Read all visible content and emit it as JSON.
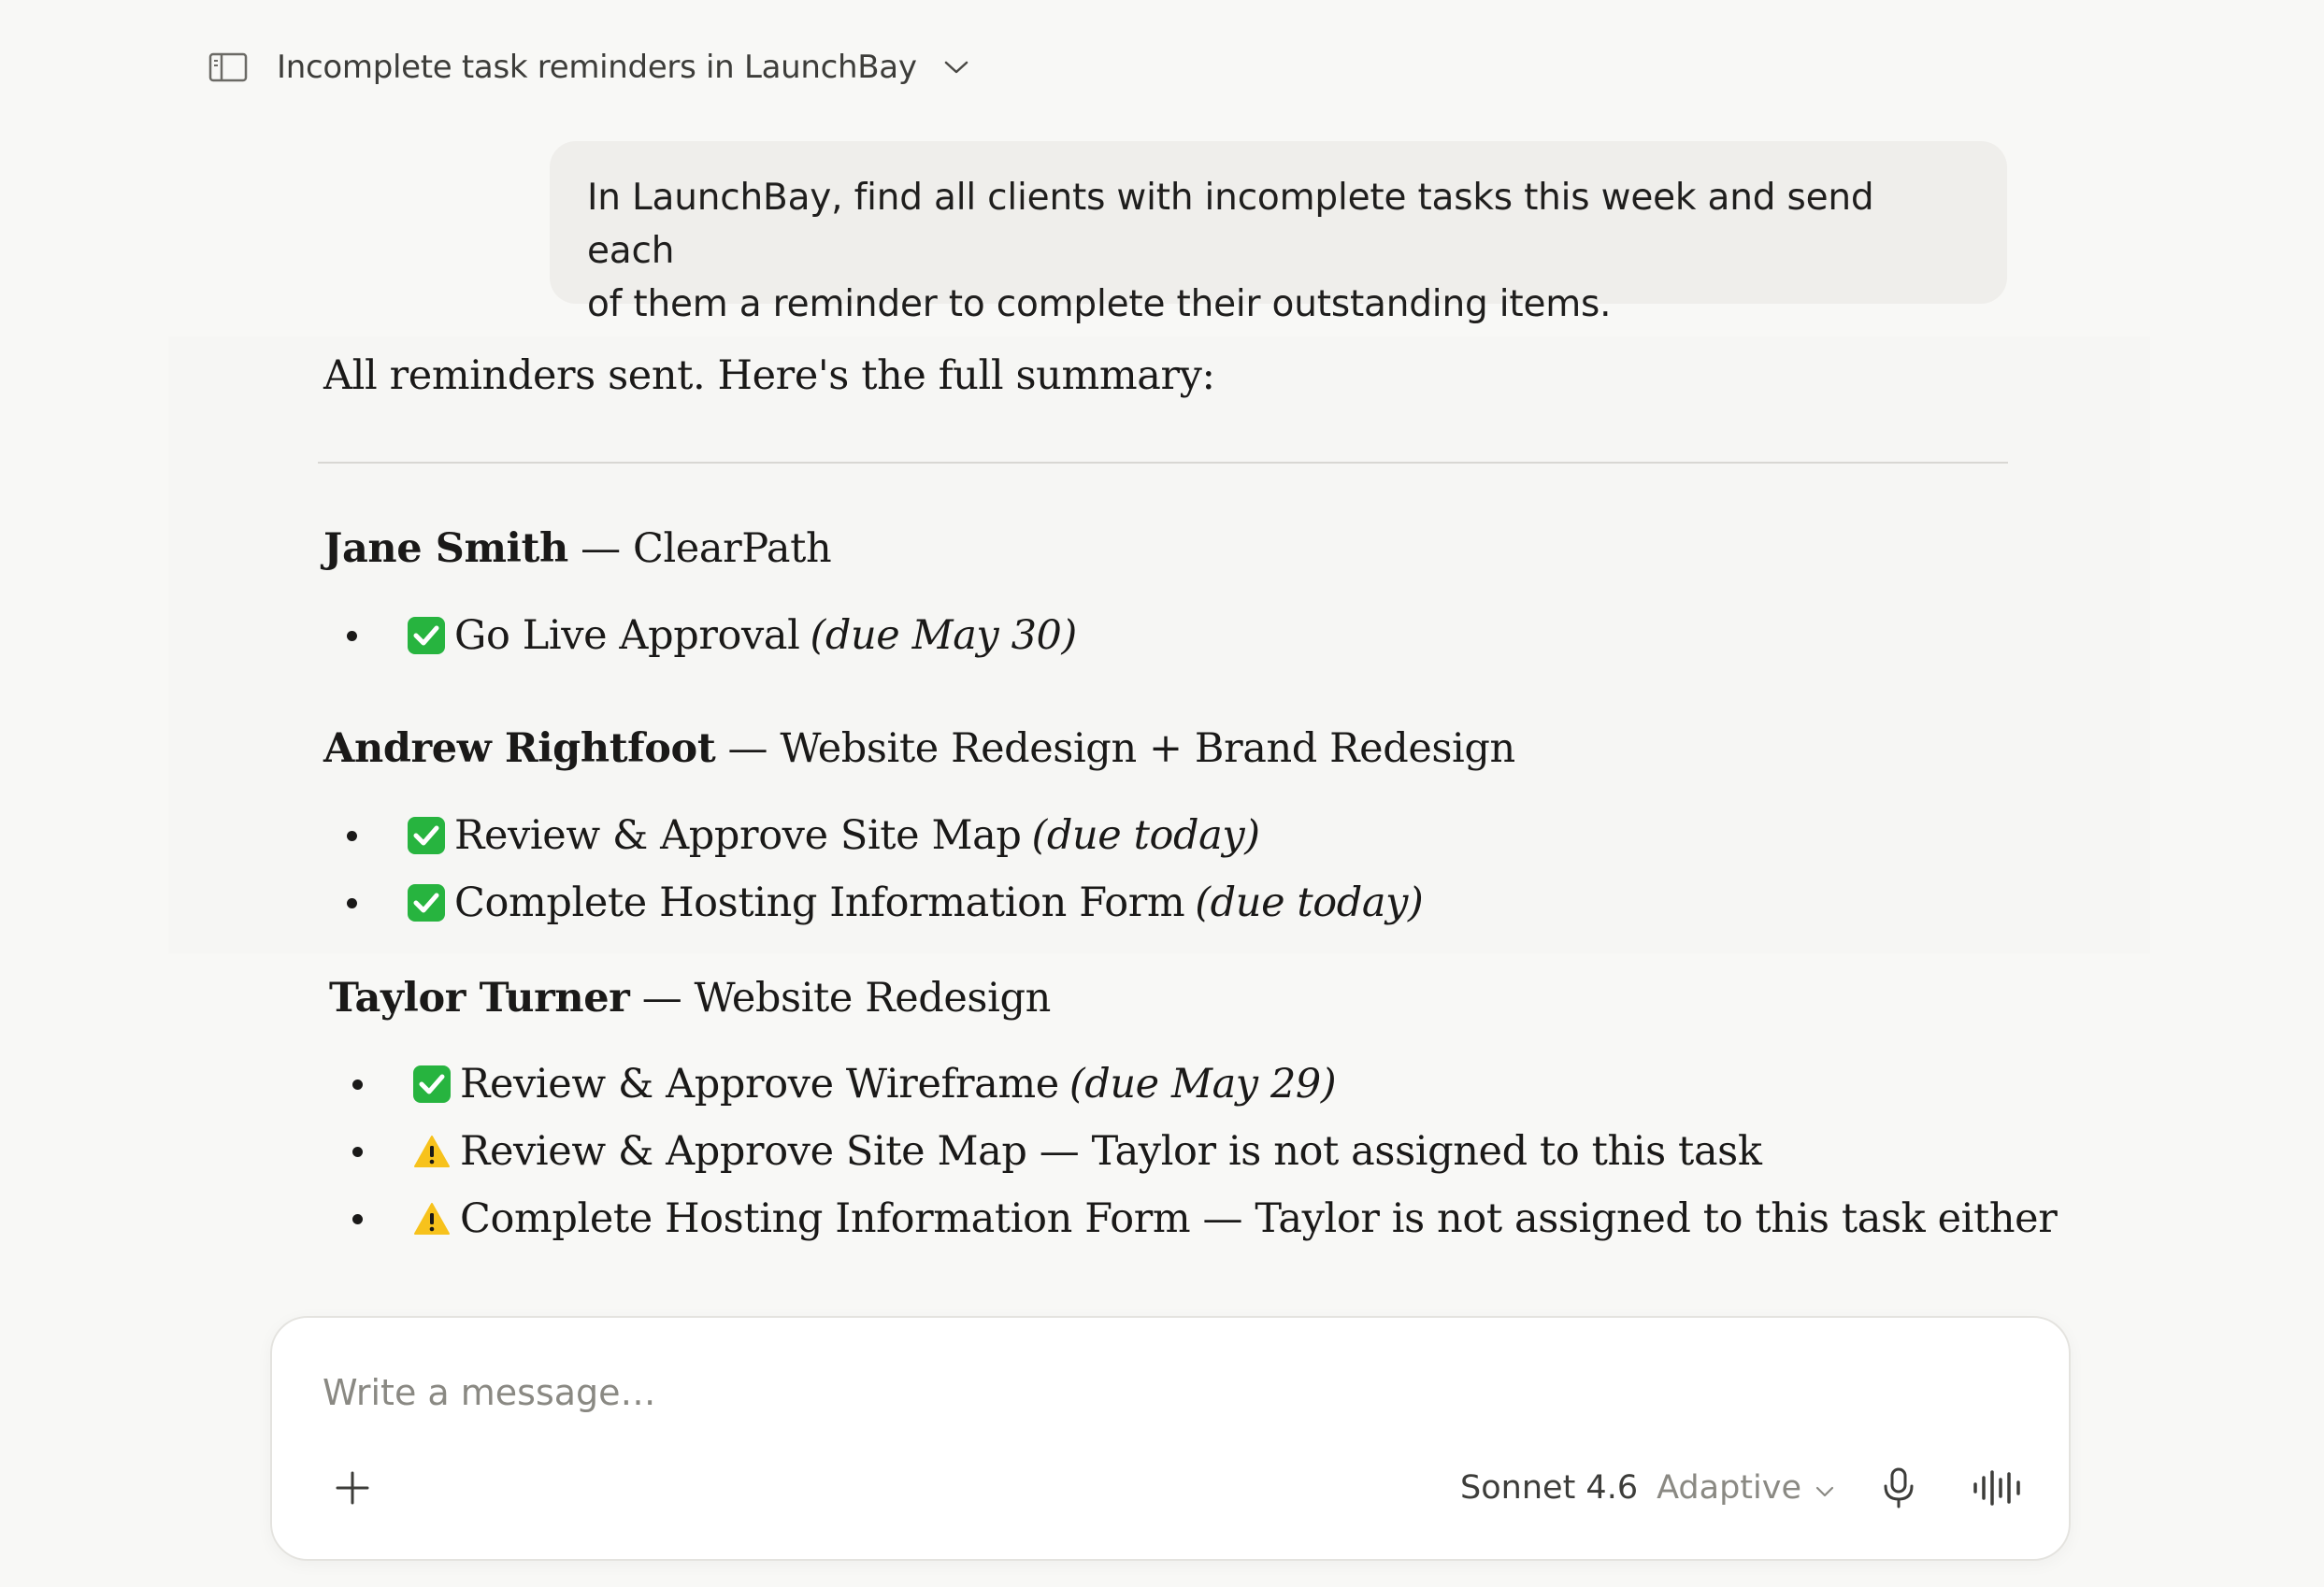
{
  "header": {
    "conversation_title": "Incomplete task reminders in LaunchBay"
  },
  "user_message": {
    "line1": "In LaunchBay, find all clients with incomplete tasks this week and send each",
    "line2": "of them a reminder to complete their outstanding items."
  },
  "assistant": {
    "intro": "All reminders sent. Here's the full summary:",
    "clients": [
      {
        "name": "Jane Smith",
        "project": " — ClearPath",
        "tasks": [
          {
            "status": "check",
            "label": "Go Live Approval",
            "note": "(due May 30)"
          }
        ]
      },
      {
        "name": "Andrew Rightfoot",
        "project": " — Website Redesign + Brand Redesign",
        "tasks": [
          {
            "status": "check",
            "label": "Review & Approve Site Map",
            "note": "(due today)"
          },
          {
            "status": "check",
            "label": "Complete Hosting Information Form",
            "note": "(due today)"
          }
        ]
      },
      {
        "name": "Taylor Turner",
        "project": " — Website Redesign",
        "tasks": [
          {
            "status": "check",
            "label": "Review & Approve Wireframe",
            "note": "(due May 29)"
          },
          {
            "status": "warning",
            "label": "Review & Approve Site Map — Taylor is not assigned to this task",
            "note": ""
          },
          {
            "status": "warning",
            "label": "Complete Hosting Information Form — Taylor is not assigned to this task either",
            "note": ""
          }
        ]
      }
    ]
  },
  "composer": {
    "placeholder": "Write a message…",
    "model": "Sonnet 4.6",
    "mode": "Adaptive"
  },
  "icons": {
    "sidebar_toggle": "sidebar-icon",
    "title_dropdown": "chevron-down-icon",
    "check": "check-mark-button-icon",
    "warning": "warning-icon",
    "add": "plus-icon",
    "mic": "microphone-icon",
    "voice": "voice-waveform-icon"
  },
  "colors": {
    "background": "#f8f8f6",
    "user_bubble": "#efeeeb",
    "check_green": "#27b43f",
    "warning_yellow": "#f7c21c"
  }
}
